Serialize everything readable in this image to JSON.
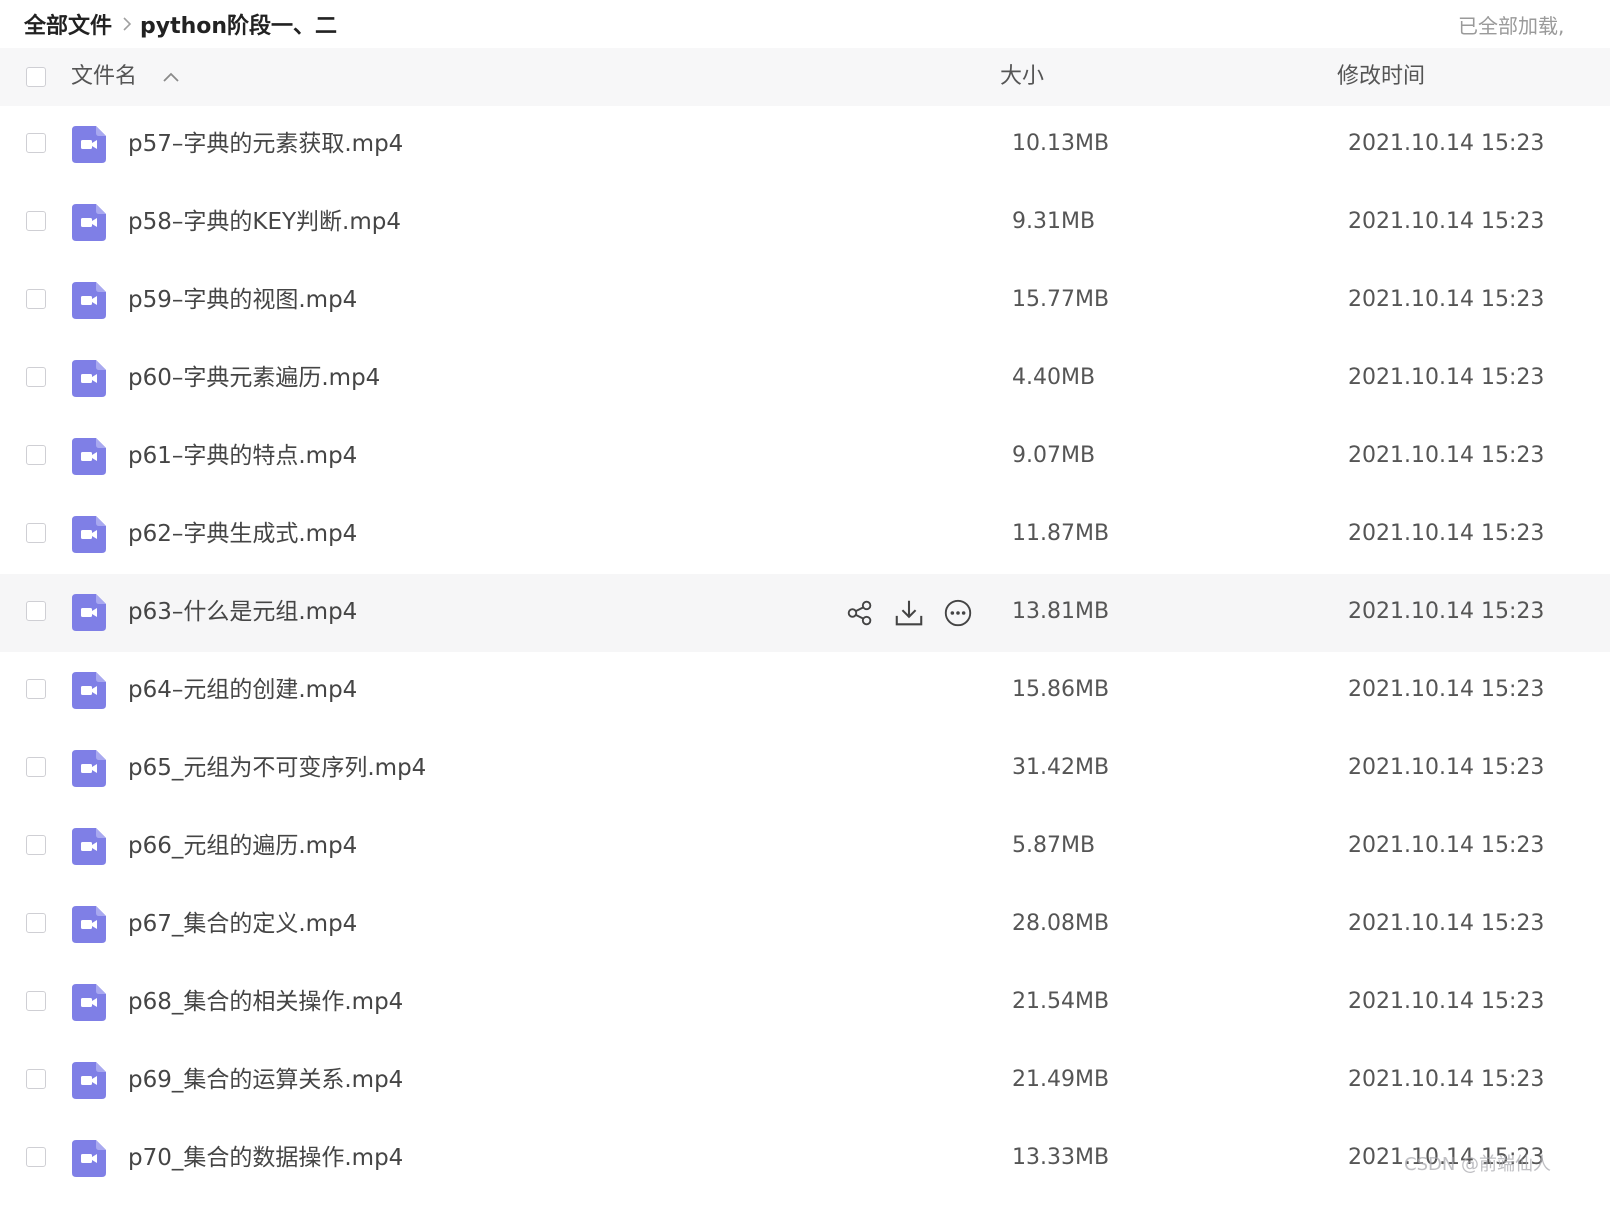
{
  "breadcrumb": {
    "root": "全部文件",
    "current": "python阶段一、二"
  },
  "load_status": "已全部加载,",
  "table": {
    "columns": {
      "name": "文件名",
      "size": "大小",
      "modified": "修改时间"
    },
    "sort": {
      "column": "name",
      "direction": "ascending",
      "icon": "chevron-up-icon"
    },
    "rows": [
      {
        "name": "p57–字典的元素获取.mp4",
        "size": "10.13MB",
        "modified": "2021.10.14 15:23",
        "icon": "video-file-icon"
      },
      {
        "name": "p58–字典的KEY判断.mp4",
        "size": "9.31MB",
        "modified": "2021.10.14 15:23",
        "icon": "video-file-icon"
      },
      {
        "name": "p59–字典的视图.mp4",
        "size": "15.77MB",
        "modified": "2021.10.14 15:23",
        "icon": "video-file-icon"
      },
      {
        "name": "p60–字典元素遍历.mp4",
        "size": "4.40MB",
        "modified": "2021.10.14 15:23",
        "icon": "video-file-icon"
      },
      {
        "name": "p61–字典的特点.mp4",
        "size": "9.07MB",
        "modified": "2021.10.14 15:23",
        "icon": "video-file-icon"
      },
      {
        "name": "p62–字典生成式.mp4",
        "size": "11.87MB",
        "modified": "2021.10.14 15:23",
        "icon": "video-file-icon"
      },
      {
        "name": "p63–什么是元组.mp4",
        "size": "13.81MB",
        "modified": "2021.10.14 15:23",
        "icon": "video-file-icon",
        "hovered": true
      },
      {
        "name": "p64–元组的创建.mp4",
        "size": "15.86MB",
        "modified": "2021.10.14 15:23",
        "icon": "video-file-icon"
      },
      {
        "name": "p65_元组为不可变序列.mp4",
        "size": "31.42MB",
        "modified": "2021.10.14 15:23",
        "icon": "video-file-icon"
      },
      {
        "name": "p66_元组的遍历.mp4",
        "size": "5.87MB",
        "modified": "2021.10.14 15:23",
        "icon": "video-file-icon"
      },
      {
        "name": "p67_集合的定义.mp4",
        "size": "28.08MB",
        "modified": "2021.10.14 15:23",
        "icon": "video-file-icon"
      },
      {
        "name": "p68_集合的相关操作.mp4",
        "size": "21.54MB",
        "modified": "2021.10.14 15:23",
        "icon": "video-file-icon"
      },
      {
        "name": "p69_集合的运算关系.mp4",
        "size": "21.49MB",
        "modified": "2021.10.14 15:23",
        "icon": "video-file-icon"
      },
      {
        "name": "p70_集合的数据操作.mp4",
        "size": "13.33MB",
        "modified": "2021.10.14 15:23",
        "icon": "video-file-icon"
      }
    ],
    "row_actions": [
      "share-icon",
      "download-icon",
      "more-icon"
    ]
  },
  "colors": {
    "header_bg": "#f7f7f8",
    "hover_row_bg": "#f6f6f7",
    "video_icon": "#7f7fe6",
    "text": "#454545",
    "muted": "#9a9a9a"
  },
  "watermark": "CSDN @前端仙人"
}
